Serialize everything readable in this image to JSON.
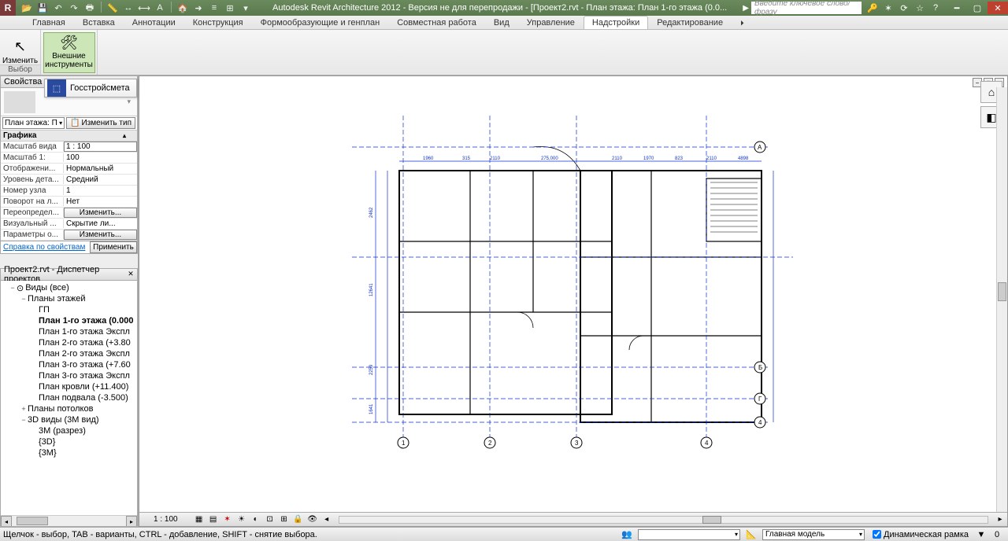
{
  "titlebar": {
    "app_letter": "R",
    "title": "Autodesk Revit Architecture 2012 - Версия не для перепродажи - [Проект2.rvt - План этажа: План 1-го этажа (0.0...",
    "search_placeholder": "Введите ключевое слово/фразу"
  },
  "ribbon": {
    "tabs": [
      "Главная",
      "Вставка",
      "Аннотации",
      "Конструкция",
      "Формообразующие и генплан",
      "Совместная работа",
      "Вид",
      "Управление",
      "Надстройки",
      "Редактирование"
    ],
    "active_tab": "Надстройки",
    "modify_btn": "Изменить",
    "external_btn": "Внешние\nинструменты",
    "group_select": "Выбор",
    "subtool": "Госстройсмета"
  },
  "properties": {
    "panel_title": "Свойства",
    "type_combo": "План этажа: П",
    "edit_type_btn": "Изменить тип",
    "section": "Графика",
    "rows": [
      {
        "n": "Масштаб вида",
        "v": "1 : 100",
        "input": true
      },
      {
        "n": "Масштаб    1:",
        "v": "100"
      },
      {
        "n": "Отображени...",
        "v": "Нормальный"
      },
      {
        "n": "Уровень дета...",
        "v": "Средний"
      },
      {
        "n": "Номер узла",
        "v": "1"
      },
      {
        "n": "Поворот на л...",
        "v": "Нет"
      },
      {
        "n": "Переопредел...",
        "v": "Изменить...",
        "btn": true
      },
      {
        "n": "Визуальный ...",
        "v": "Скрытие ли..."
      },
      {
        "n": "Параметры о...",
        "v": "Изменить...",
        "btn": true
      }
    ],
    "help_link": "Справка по свойствам",
    "apply_btn": "Применить"
  },
  "browser": {
    "panel_title": "Проект2.rvt - Диспетчер проектов",
    "nodes": [
      {
        "l": "Виды (все)",
        "ind": 1,
        "tw": "−",
        "ico": "⊙"
      },
      {
        "l": "Планы этажей",
        "ind": 2,
        "tw": "−"
      },
      {
        "l": "ГП",
        "ind": 3
      },
      {
        "l": "План 1-го этажа (0.000",
        "ind": 3,
        "bold": true
      },
      {
        "l": "План 1-го этажа Экспл",
        "ind": 3
      },
      {
        "l": "План 2-го этажа (+3.80",
        "ind": 3
      },
      {
        "l": "План 2-го этажа Экспл",
        "ind": 3
      },
      {
        "l": "План 3-го этажа (+7.60",
        "ind": 3
      },
      {
        "l": "План 3-го этажа Экспл",
        "ind": 3
      },
      {
        "l": "План кровли (+11.400)",
        "ind": 3
      },
      {
        "l": "План подвала (-3.500)",
        "ind": 3
      },
      {
        "l": "Планы потолков",
        "ind": 2,
        "tw": "+"
      },
      {
        "l": "3D виды (3М вид)",
        "ind": 2,
        "tw": "−"
      },
      {
        "l": "3М (разрез)",
        "ind": 3
      },
      {
        "l": "{3D}",
        "ind": 3
      },
      {
        "l": "{3М}",
        "ind": 3
      }
    ]
  },
  "viewbar": {
    "scale": "1 : 100"
  },
  "status": {
    "msg": "Щелчок - выбор, TAB - варианты, CTRL - добавление, SHIFT - снятие выбора.",
    "combo1": "",
    "combo2": "Главная модель",
    "chk_label": "Динамическая рамка"
  }
}
